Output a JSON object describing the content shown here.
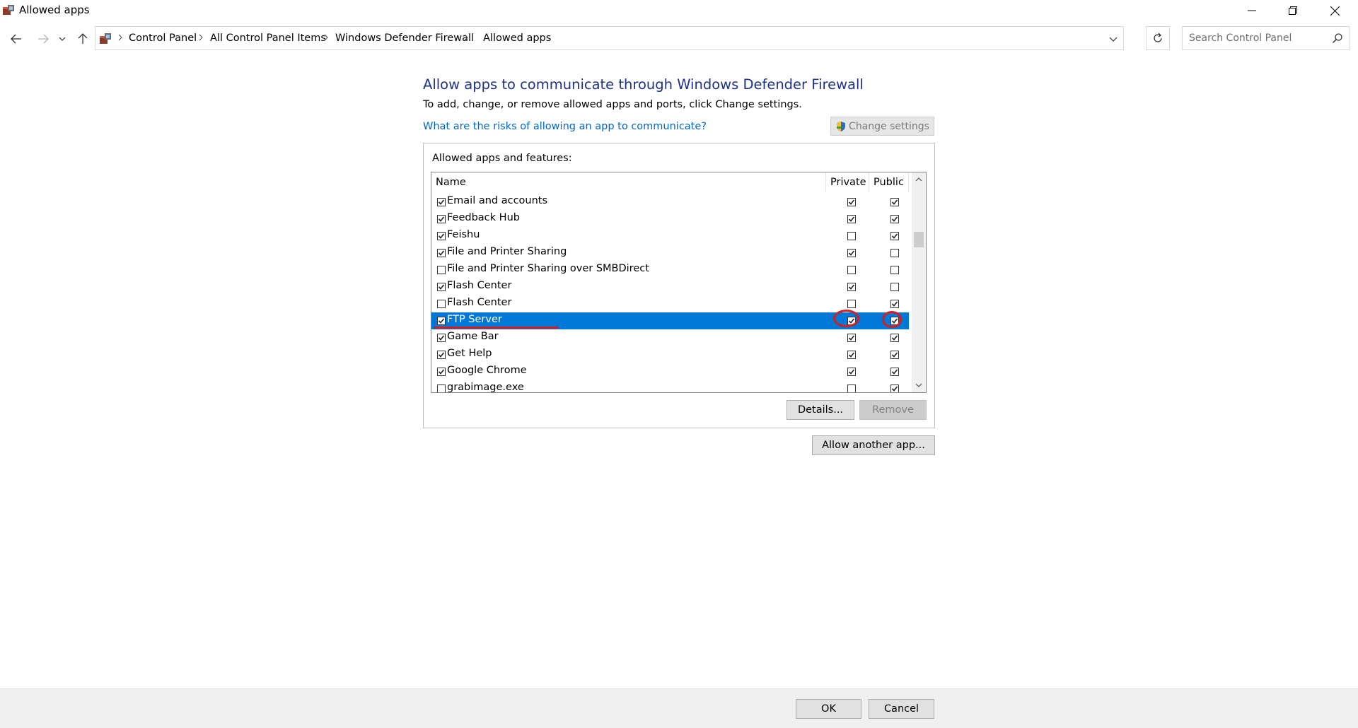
{
  "window": {
    "title": "Allowed apps"
  },
  "address": {
    "crumbs": [
      "Control Panel",
      "All Control Panel Items",
      "Windows Defender Firewall",
      "Allowed apps"
    ]
  },
  "search": {
    "placeholder": "Search Control Panel"
  },
  "main": {
    "heading": "Allow apps to communicate through Windows Defender Firewall",
    "subtext": "To add, change, or remove allowed apps and ports, click Change settings.",
    "risk_link": "What are the risks of allowing an app to communicate?",
    "change_settings": "Change settings"
  },
  "list": {
    "group_label": "Allowed apps and features:",
    "headers": {
      "name": "Name",
      "private": "Private",
      "public": "Public"
    },
    "rows": [
      {
        "name": "Email and accounts",
        "enabled": true,
        "private": true,
        "public": true,
        "selected": false
      },
      {
        "name": "Feedback Hub",
        "enabled": true,
        "private": true,
        "public": true,
        "selected": false
      },
      {
        "name": "Feishu",
        "enabled": true,
        "private": false,
        "public": true,
        "selected": false
      },
      {
        "name": "File and Printer Sharing",
        "enabled": true,
        "private": true,
        "public": false,
        "selected": false
      },
      {
        "name": "File and Printer Sharing over SMBDirect",
        "enabled": false,
        "private": false,
        "public": false,
        "selected": false
      },
      {
        "name": "Flash Center",
        "enabled": true,
        "private": true,
        "public": false,
        "selected": false
      },
      {
        "name": "Flash Center",
        "enabled": false,
        "private": false,
        "public": true,
        "selected": false
      },
      {
        "name": "FTP Server",
        "enabled": true,
        "private": true,
        "public": true,
        "selected": true
      },
      {
        "name": "Game Bar",
        "enabled": true,
        "private": true,
        "public": true,
        "selected": false
      },
      {
        "name": "Get Help",
        "enabled": true,
        "private": true,
        "public": true,
        "selected": false
      },
      {
        "name": "Google Chrome",
        "enabled": true,
        "private": true,
        "public": true,
        "selected": false
      },
      {
        "name": "grabimage.exe",
        "enabled": false,
        "private": false,
        "public": true,
        "selected": false
      }
    ]
  },
  "buttons": {
    "details": "Details...",
    "remove": "Remove",
    "allow_another": "Allow another app...",
    "ok": "OK",
    "cancel": "Cancel"
  },
  "colors": {
    "heading": "#1e3287",
    "link": "#0066cc",
    "selection": "#0078d7",
    "annotation": "#d81b1b"
  }
}
